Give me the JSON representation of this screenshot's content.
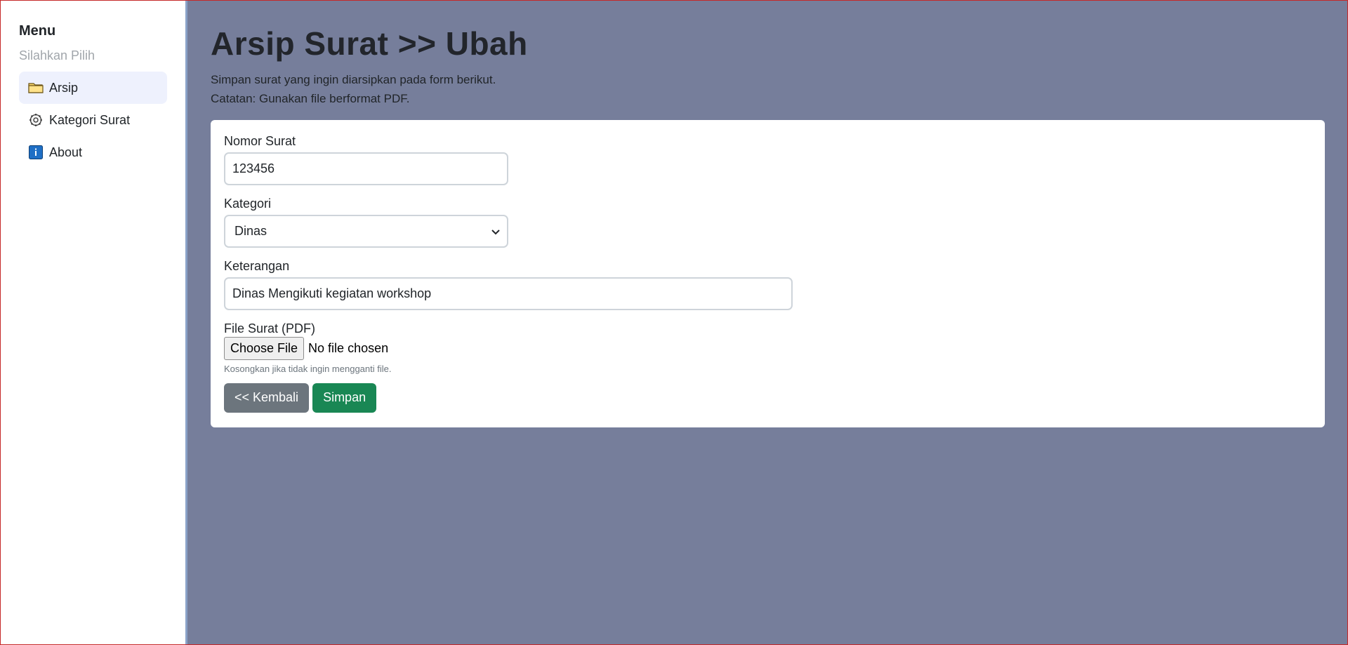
{
  "sidebar": {
    "title": "Menu",
    "subtitle": "Silahkan Pilih",
    "items": [
      {
        "label": "Arsip",
        "icon": "folder-icon",
        "active": true
      },
      {
        "label": "Kategori Surat",
        "icon": "gear-icon",
        "active": false
      },
      {
        "label": "About",
        "icon": "info-icon",
        "active": false
      }
    ]
  },
  "header": {
    "title": "Arsip Surat >> Ubah",
    "desc_line1": "Simpan surat yang ingin diarsipkan pada form berikut.",
    "desc_line2": "Catatan: Gunakan file berformat PDF."
  },
  "form": {
    "nomor_label": "Nomor Surat",
    "nomor_value": "123456",
    "kategori_label": "Kategori",
    "kategori_value": "Dinas",
    "keterangan_label": "Keterangan",
    "keterangan_value": "Dinas Mengikuti kegiatan workshop",
    "file_label": "File Surat (PDF)",
    "file_button": "Choose File",
    "file_status": "No file chosen",
    "file_hint": "Kosongkan jika tidak ingin mengganti file.",
    "back_label": "<< Kembali",
    "save_label": "Simpan"
  },
  "colors": {
    "main_bg": "#767e9b",
    "back_button": "#6c757d",
    "save_button": "#198754",
    "active_nav": "#eef1fd"
  }
}
